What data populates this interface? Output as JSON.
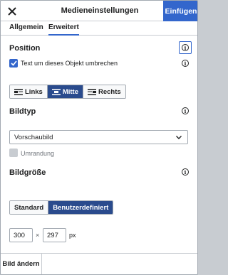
{
  "dialog": {
    "title": "Medieneinstellungen",
    "insert_label": "Einfügen",
    "accent_color": "#3366cc"
  },
  "tabs": [
    {
      "label": "Allgemein",
      "active": false
    },
    {
      "label": "Erweitert",
      "active": true
    }
  ],
  "position": {
    "heading": "Position",
    "wrap_label": "Text um dieses Objekt umbrechen",
    "wrap_checked": true,
    "align_options": [
      "Links",
      "Mitte",
      "Rechts"
    ],
    "align_selected": "Mitte"
  },
  "image_type": {
    "heading": "Bildtyp",
    "selected": "Vorschaubild",
    "border_label": "Umrandung",
    "border_checked": false
  },
  "image_size": {
    "heading": "Bildgröße",
    "options": [
      "Standard",
      "Benutzerdefiniert"
    ],
    "selected": "Benutzerdefiniert",
    "width": "300",
    "separator": "×",
    "height": "297",
    "unit": "px"
  },
  "footer": {
    "change_label": "Bild ändern"
  }
}
